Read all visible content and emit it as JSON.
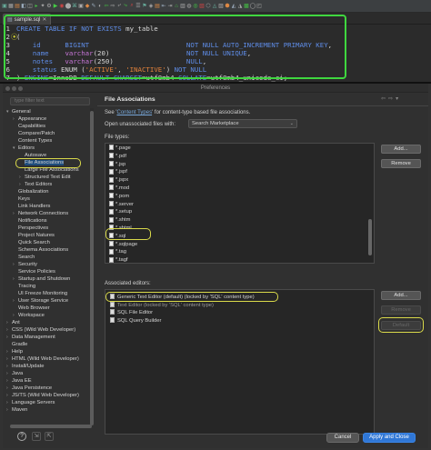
{
  "editor": {
    "tab_label": "sample.sql",
    "lines": [
      {
        "n": "1",
        "parts": [
          [
            "kw",
            "CREATE TABLE IF NOT EXISTS "
          ],
          [
            "id",
            "my_table"
          ]
        ]
      },
      {
        "n": "2",
        "parts": [
          [
            "pl",
            "("
          ]
        ]
      },
      {
        "n": "3",
        "parts": [
          [
            "pl",
            "    "
          ],
          [
            "kw",
            "id"
          ],
          [
            "pl",
            "      "
          ],
          [
            "kw",
            "BIGINT"
          ],
          [
            "pl",
            "                        "
          ],
          [
            "kw",
            "NOT NULL AUTO_INCREMENT PRIMARY KEY"
          ],
          [
            "pl",
            ","
          ]
        ]
      },
      {
        "n": "4",
        "parts": [
          [
            "pl",
            "    "
          ],
          [
            "kw",
            "name"
          ],
          [
            "pl",
            "    "
          ],
          [
            "ty",
            "varchar"
          ],
          [
            "pl",
            "(20)                   "
          ],
          [
            "kw",
            "NOT NULL UNIQUE"
          ],
          [
            "pl",
            ","
          ]
        ]
      },
      {
        "n": "5",
        "parts": [
          [
            "pl",
            "    "
          ],
          [
            "kw",
            "notes"
          ],
          [
            "pl",
            "   "
          ],
          [
            "ty",
            "varchar"
          ],
          [
            "pl",
            "(250)                  "
          ],
          [
            "kw",
            "NULL"
          ],
          [
            "pl",
            ","
          ]
        ]
      },
      {
        "n": "6",
        "parts": [
          [
            "pl",
            "    "
          ],
          [
            "kw",
            "status"
          ],
          [
            "pl",
            " ENUM ("
          ],
          [
            "st",
            "'ACTIVE'"
          ],
          [
            "pl",
            ", "
          ],
          [
            "st",
            "'INACTIVE'"
          ],
          [
            "pl",
            ") "
          ],
          [
            "kw",
            "NOT NULL"
          ]
        ]
      },
      {
        "n": "7",
        "parts": [
          [
            "pl",
            ") "
          ],
          [
            "kw",
            "ENGINE"
          ],
          [
            "pl",
            "=InnoDB "
          ],
          [
            "kw",
            "DEFAULT CHARSET"
          ],
          [
            "pl",
            "=utf8mb4 "
          ],
          [
            "kw",
            "COLLATE"
          ],
          [
            "pl",
            "=utf8mb4_unicode_ci;"
          ]
        ]
      }
    ]
  },
  "dialog": {
    "title": "Preferences",
    "filter_placeholder": "type filter text",
    "nav_back": "⇦",
    "nav_menu": "▾",
    "tree": [
      {
        "d": 0,
        "arrow": "▾",
        "label": "General"
      },
      {
        "d": 1,
        "arrow": "›",
        "label": "Appearance"
      },
      {
        "d": 1,
        "arrow": "",
        "label": "Capabilities"
      },
      {
        "d": 1,
        "arrow": "",
        "label": "Compare/Patch"
      },
      {
        "d": 1,
        "arrow": "",
        "label": "Content Types"
      },
      {
        "d": 1,
        "arrow": "▾",
        "label": "Editors"
      },
      {
        "d": 2,
        "arrow": "",
        "label": "Autosave"
      },
      {
        "d": 2,
        "arrow": "",
        "label": "File Associations",
        "sel": true
      },
      {
        "d": 2,
        "arrow": "",
        "label": "Large File Associations"
      },
      {
        "d": 2,
        "arrow": "›",
        "label": "Structured Text Edit"
      },
      {
        "d": 2,
        "arrow": "›",
        "label": "Text Editors"
      },
      {
        "d": 1,
        "arrow": "",
        "label": "Globalization"
      },
      {
        "d": 1,
        "arrow": "",
        "label": "Keys"
      },
      {
        "d": 1,
        "arrow": "",
        "label": "Link Handlers"
      },
      {
        "d": 1,
        "arrow": "›",
        "label": "Network Connections"
      },
      {
        "d": 1,
        "arrow": "",
        "label": "Notifications"
      },
      {
        "d": 1,
        "arrow": "",
        "label": "Perspectives"
      },
      {
        "d": 1,
        "arrow": "",
        "label": "Project Natures"
      },
      {
        "d": 1,
        "arrow": "",
        "label": "Quick Search"
      },
      {
        "d": 1,
        "arrow": "",
        "label": "Schema Associations"
      },
      {
        "d": 1,
        "arrow": "",
        "label": "Search"
      },
      {
        "d": 1,
        "arrow": "›",
        "label": "Security"
      },
      {
        "d": 1,
        "arrow": "",
        "label": "Service Policies"
      },
      {
        "d": 1,
        "arrow": "›",
        "label": "Startup and Shutdown"
      },
      {
        "d": 1,
        "arrow": "",
        "label": "Tracing"
      },
      {
        "d": 1,
        "arrow": "",
        "label": "UI Freeze Monitoring"
      },
      {
        "d": 1,
        "arrow": "›",
        "label": "User Storage Service"
      },
      {
        "d": 1,
        "arrow": "",
        "label": "Web Browser"
      },
      {
        "d": 1,
        "arrow": "›",
        "label": "Workspace"
      },
      {
        "d": 0,
        "arrow": "›",
        "label": "Ant"
      },
      {
        "d": 0,
        "arrow": "›",
        "label": "CSS (Wild Web Developer)"
      },
      {
        "d": 0,
        "arrow": "›",
        "label": "Data Management"
      },
      {
        "d": 0,
        "arrow": "",
        "label": "Gradle"
      },
      {
        "d": 0,
        "arrow": "›",
        "label": "Help"
      },
      {
        "d": 0,
        "arrow": "›",
        "label": "HTML (Wild Web Developer)"
      },
      {
        "d": 0,
        "arrow": "›",
        "label": "Install/Update"
      },
      {
        "d": 0,
        "arrow": "›",
        "label": "Java"
      },
      {
        "d": 0,
        "arrow": "›",
        "label": "Java EE"
      },
      {
        "d": 0,
        "arrow": "›",
        "label": "Java Persistence"
      },
      {
        "d": 0,
        "arrow": "›",
        "label": "JS/TS (Wild Web Developer)"
      },
      {
        "d": 0,
        "arrow": "›",
        "label": "Language Servers"
      },
      {
        "d": 0,
        "arrow": "›",
        "label": "Maven"
      }
    ],
    "page_title": "File Associations",
    "desc_prefix": "See '",
    "desc_link": "Content Types",
    "desc_suffix": "' for content-type based file associations.",
    "open_unassoc_label": "Open unassociated files with:",
    "open_unassoc_value": "Search Marketplace",
    "file_types_label": "File types:",
    "file_types": [
      "*.page",
      "*.pdf",
      "*.jsp",
      "*.jspf",
      "*.jspx",
      "*.mod",
      "*.pom",
      "*.server",
      "*.setup",
      "*.shtm",
      "*.shtml",
      "*.sql",
      "*.sqlpage",
      "*.tag",
      "*.tagf"
    ],
    "btn_add": "Add...",
    "btn_remove": "Remove",
    "assoc_label": "Associated editors:",
    "assoc_editors": [
      {
        "label": "Generic Text Editor (default) (locked by 'SQL' content type)",
        "dim": false
      },
      {
        "label": "Text Editor (locked by 'SQL' content type)",
        "dim": true
      },
      {
        "label": "SQL File Editor",
        "dim": false
      },
      {
        "label": "SQL Query Builder",
        "dim": false
      }
    ],
    "btn_add2": "Add...",
    "btn_remove2": "Remove",
    "btn_default": "Default",
    "help": "?",
    "import_icon": "⇲",
    "export_icon": "⇱",
    "cancel": "Cancel",
    "apply_close": "Apply and Close"
  }
}
